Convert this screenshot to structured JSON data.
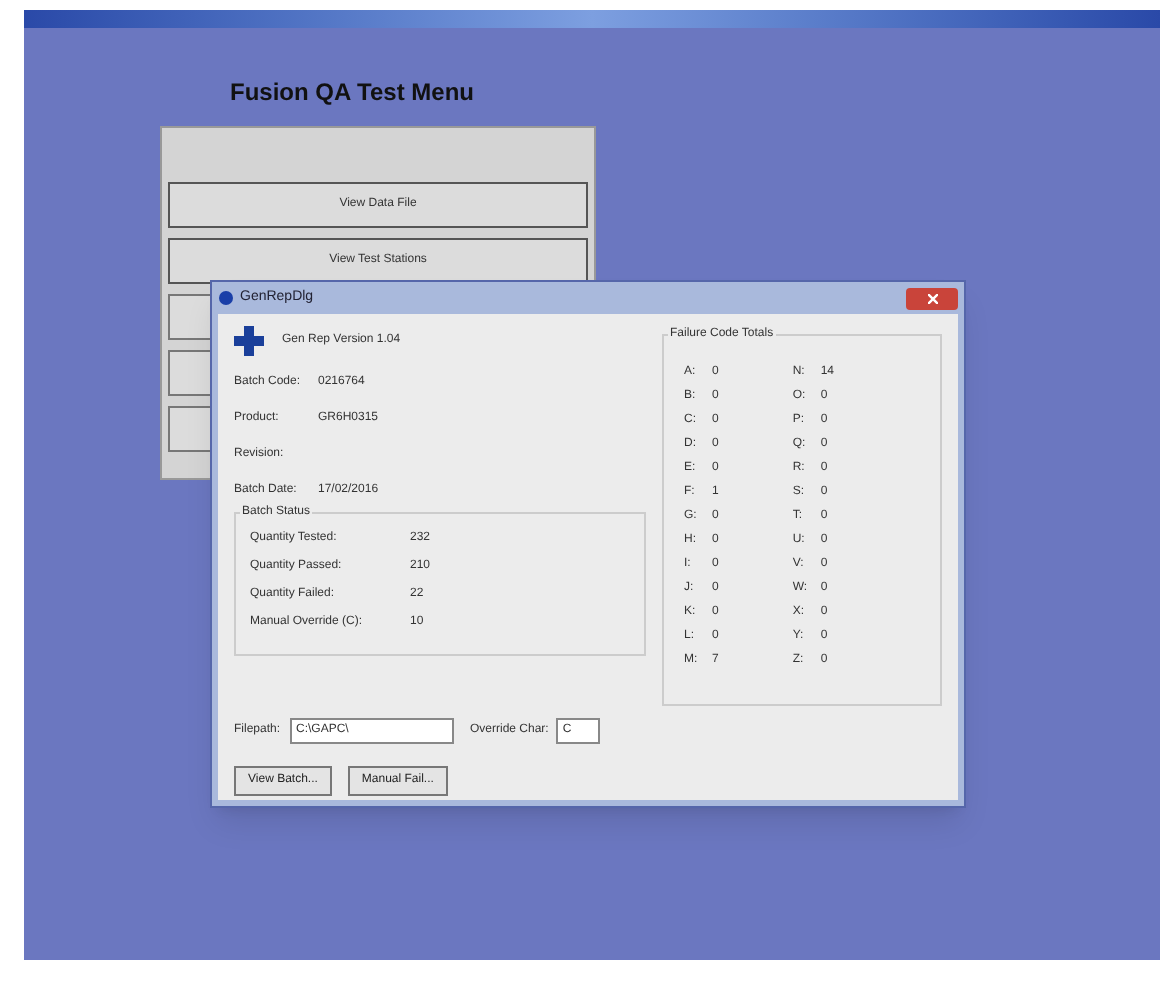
{
  "menu": {
    "title": "Fusion QA Test Menu",
    "buttons": [
      "View Data File",
      "View Test Stations"
    ]
  },
  "dialog": {
    "title": "GenRepDlg",
    "version": "Gen Rep Version 1.04",
    "fields": [
      {
        "label": "Batch Code:",
        "value": "0216764"
      },
      {
        "label": "Product:",
        "value": "GR6H0315"
      },
      {
        "label": "Revision:"
      },
      {
        "label": "Batch Date:",
        "value": "17/02/2016"
      }
    ],
    "batch_status": {
      "title": "Batch Status",
      "rows": [
        {
          "label": "Quantity Tested:",
          "value": "232"
        },
        {
          "label": "Quantity Passed:",
          "value": "210"
        },
        {
          "label": "Quantity Failed:",
          "value": "22"
        },
        {
          "label": "Manual Override (C):",
          "value": "10"
        }
      ]
    },
    "failure_totals": {
      "title": "Failure Code Totals",
      "left": [
        {
          "code": "A:",
          "count": "0"
        },
        {
          "code": "B:",
          "count": "0"
        },
        {
          "code": "C:",
          "count": "0"
        },
        {
          "code": "D:",
          "count": "0"
        },
        {
          "code": "E:",
          "count": "0"
        },
        {
          "code": "F:",
          "count": "1"
        },
        {
          "code": "G:",
          "count": "0"
        },
        {
          "code": "H:",
          "count": "0"
        },
        {
          "code": "I:",
          "count": "0"
        },
        {
          "code": "J:",
          "count": "0"
        },
        {
          "code": "K:",
          "count": "0"
        },
        {
          "code": "L:",
          "count": "0"
        },
        {
          "code": "M:",
          "count": "7"
        }
      ],
      "right": [
        {
          "code": "N:",
          "count": "14"
        },
        {
          "code": "O:",
          "count": "0"
        },
        {
          "code": "P:",
          "count": "0"
        },
        {
          "code": "Q:",
          "count": "0"
        },
        {
          "code": "R:",
          "count": "0"
        },
        {
          "code": "S:",
          "count": "0"
        },
        {
          "code": "T:",
          "count": "0"
        },
        {
          "code": "U:",
          "count": "0"
        },
        {
          "code": "V:",
          "count": "0"
        },
        {
          "code": "W:",
          "count": "0"
        },
        {
          "code": "X:",
          "count": "0"
        },
        {
          "code": "Y:",
          "count": "0"
        },
        {
          "code": "Z:",
          "count": "0"
        }
      ]
    },
    "filepath": {
      "label": "Filepath:",
      "value": "C:\\GAPC\\"
    },
    "override_char": {
      "label": "Override Char:",
      "value": "C"
    },
    "buttons": [
      "View Batch...",
      "Manual Fail..."
    ]
  }
}
